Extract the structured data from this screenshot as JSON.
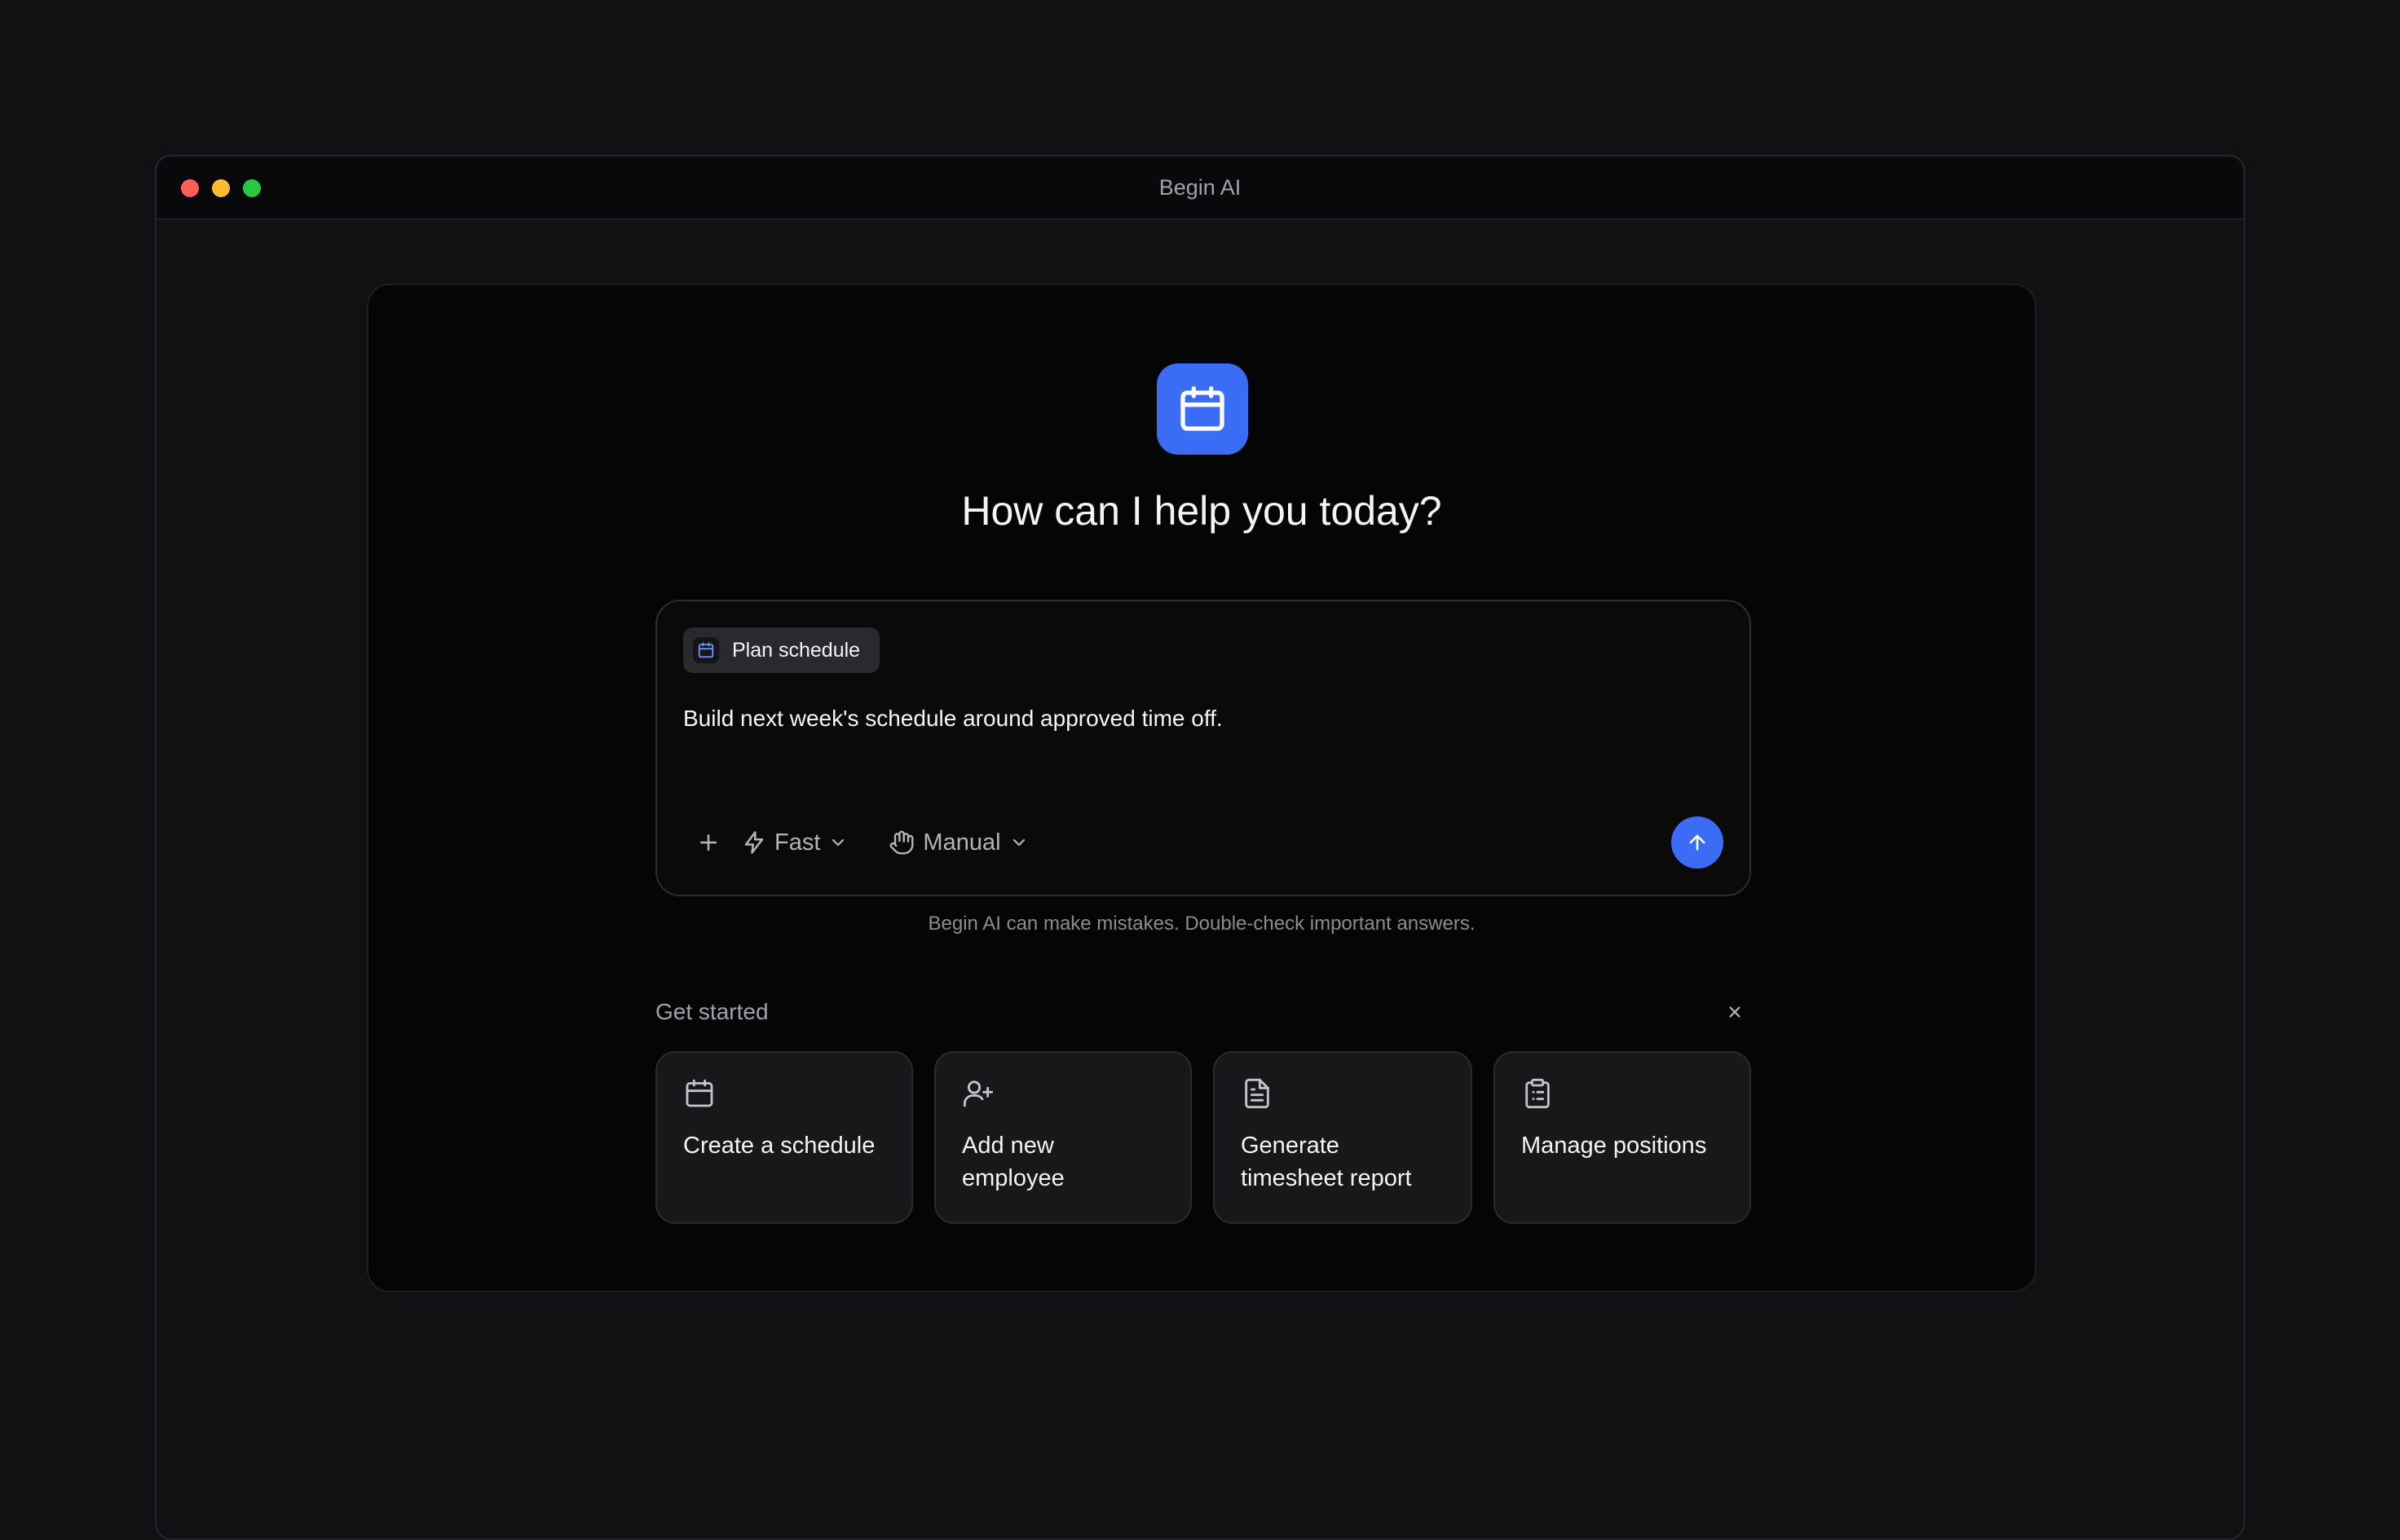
{
  "window": {
    "title": "Begin AI",
    "traffic_lights": {
      "close": "#ff5f57",
      "minimize": "#febc2e",
      "maximize": "#28c840"
    }
  },
  "hero": {
    "icon": "calendar-icon",
    "accent_color": "#3b6cf6",
    "headline": "How can I help you today?"
  },
  "composer": {
    "chip": {
      "icon": "calendar-icon",
      "label": "Plan schedule"
    },
    "text": "Build next week's schedule around approved time off.",
    "toolbar": {
      "attach_icon": "plus-icon",
      "speed": {
        "icon": "lightning-icon",
        "label": "Fast"
      },
      "mode": {
        "icon": "hand-icon",
        "label": "Manual"
      },
      "send_icon": "arrow-up-icon"
    }
  },
  "disclaimer": "Begin AI can make mistakes. Double-check important answers.",
  "get_started": {
    "title": "Get started",
    "close_icon": "close-icon",
    "cards": [
      {
        "icon": "calendar-icon",
        "label": "Create a schedule"
      },
      {
        "icon": "user-plus-icon",
        "label": "Add new employee"
      },
      {
        "icon": "document-icon",
        "label": "Generate timesheet report"
      },
      {
        "icon": "clipboard-icon",
        "label": "Manage positions"
      }
    ]
  }
}
